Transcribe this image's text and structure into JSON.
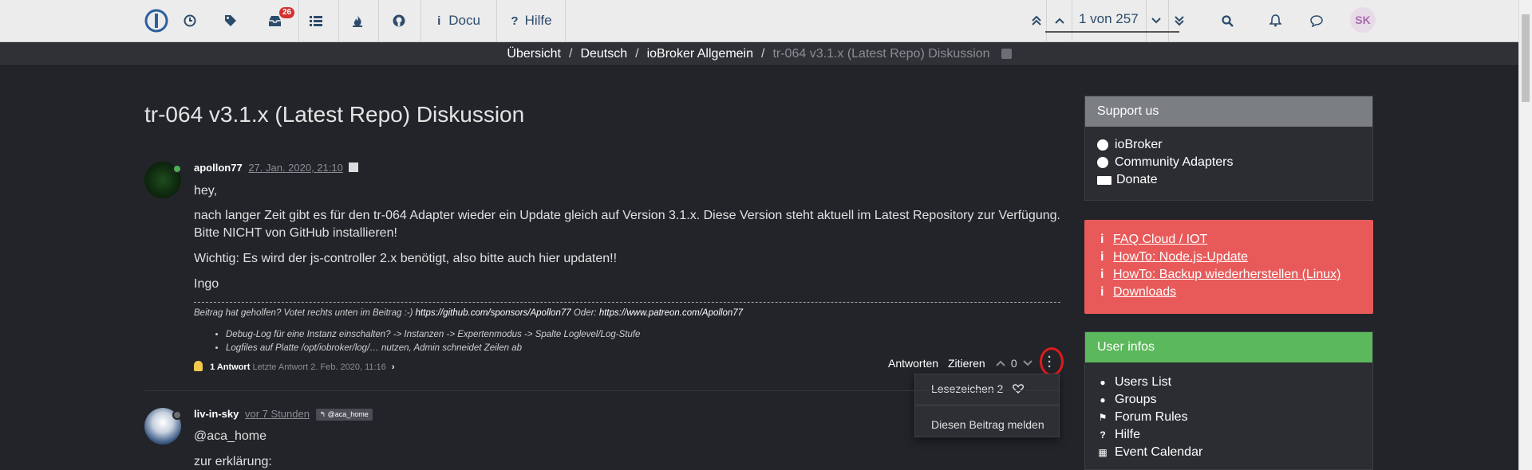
{
  "nav": {
    "notif_count": "26",
    "docu_label": "Docu",
    "hilfe_label": "Hilfe",
    "pager": "1 von 257",
    "avatar_initials": "SK"
  },
  "breadcrumb": {
    "items": [
      "Übersicht",
      "Deutsch",
      "ioBroker Allgemein"
    ],
    "current": "tr-064 v3.1.x (Latest Repo) Diskussion",
    "separator": "/"
  },
  "topic": {
    "title": "tr-064 v3.1.x (Latest Repo) Diskussion"
  },
  "post1": {
    "username": "apollon77",
    "timestamp": "27. Jan. 2020, 21:10",
    "paragraphs": [
      "hey,",
      "nach langer Zeit gibt es für den tr-064 Adapter wieder ein Update gleich auf Version 3.1.x. Diese Version steht aktuell im Latest Repository zur Verfügung.",
      "Bitte NICHT von GitHub installieren!",
      "Wichtig: Es wird der js-controller 2.x benötigt, also bitte auch hier updaten!!",
      "Ingo"
    ],
    "signature": {
      "prefix": "Beitrag hat geholfen? Votet rechts unten im Beitrag :-)",
      "link1": "https://github.com/sponsors/Apollon77",
      "oder": "Oder:",
      "link2": "https://www.patreon.com/Apollon77",
      "bullets": [
        "Debug-Log für eine Instanz einschalten? -> Instanzen -> Expertenmodus -> Spalte Loglevel/Log-Stufe",
        "Logfiles auf Platte /opt/iobroker/log/… nutzen, Admin schneidet Zeilen ab"
      ]
    },
    "replies_count": "1 Antwort",
    "last_reply": "Letzte Antwort 2. Feb. 2020, 11:16",
    "actions": {
      "reply": "Antworten",
      "quote": "Zitieren",
      "votes": "0"
    },
    "menu": {
      "bookmark": "Lesezeichen 2",
      "report": "Diesen Beitrag melden"
    }
  },
  "post2": {
    "username": "liv-in-sky",
    "timestamp": "vor 7 Stunden",
    "mention_tag": "@aca_home",
    "paragraphs": [
      "@aca_home",
      "zur erklärung:"
    ]
  },
  "sidebar": {
    "support": {
      "title": "Support us",
      "items": [
        "ioBroker",
        "Community Adapters",
        "Donate"
      ],
      "head_color": "#7b7e83"
    },
    "faq": {
      "items": [
        "FAQ Cloud / IOT",
        "HowTo: Node.js-Update",
        "HowTo: Backup wiederherstellen (Linux)",
        "Downloads"
      ],
      "color": "#e85a5a"
    },
    "userinfo": {
      "title": "User infos",
      "items": [
        "Users List",
        "Groups",
        "Forum Rules",
        "Hilfe",
        "Event Calendar"
      ],
      "head_color": "#5cb85c"
    }
  }
}
